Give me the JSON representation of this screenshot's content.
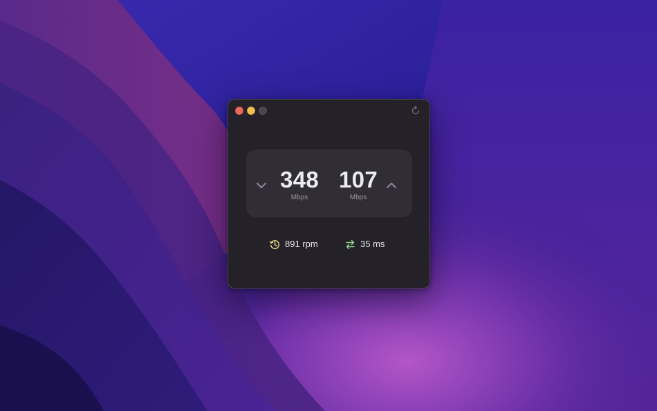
{
  "window": {
    "controls": {
      "close": "close-icon",
      "minimize": "minimize-icon",
      "zoom": "zoom-icon"
    },
    "refresh_icon": "refresh-icon"
  },
  "speed": {
    "download": {
      "value": "348",
      "unit": "Mbps",
      "icon": "chevron-down-icon"
    },
    "upload": {
      "value": "107",
      "unit": "Mbps",
      "icon": "chevron-up-icon"
    }
  },
  "stats": {
    "responsiveness": {
      "text": "891 rpm",
      "icon": "responsiveness-icon",
      "color": "#e8d48a"
    },
    "latency": {
      "text": "35 ms",
      "icon": "swap-arrows-icon",
      "color": "#8fd38a"
    }
  },
  "colors": {
    "window_bg": "#242129",
    "panel_bg": "#302d36",
    "value_text": "#ecebef",
    "unit_text": "#9995a0"
  }
}
